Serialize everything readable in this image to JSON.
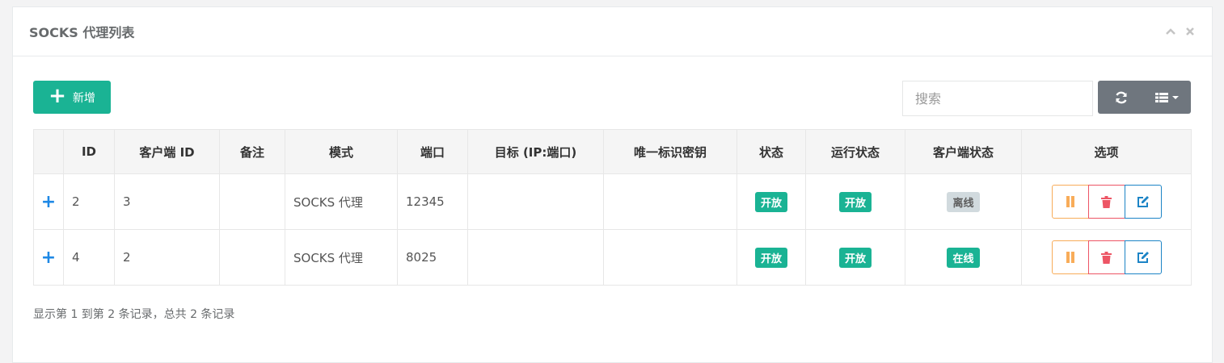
{
  "panel": {
    "title": "SOCKS 代理列表"
  },
  "toolbar": {
    "add_label": "新增",
    "search_placeholder": "搜索"
  },
  "table": {
    "headers": [
      "",
      "ID",
      "客户端 ID",
      "备注",
      "模式",
      "端口",
      "目标 (IP:端口)",
      "唯一标识密钥",
      "状态",
      "运行状态",
      "客户端状态",
      "选项"
    ],
    "rows": [
      {
        "id": "2",
        "client_id": "3",
        "remark": "",
        "mode": "SOCKS 代理",
        "port": "12345",
        "target": "",
        "key": "",
        "status": "开放",
        "run_status": "开放",
        "client_status": "离线"
      },
      {
        "id": "4",
        "client_id": "2",
        "remark": "",
        "mode": "SOCKS 代理",
        "port": "8025",
        "target": "",
        "key": "",
        "status": "开放",
        "run_status": "开放",
        "client_status": "在线"
      }
    ]
  },
  "footer": {
    "summary": "显示第 1 到第 2 条记录，总共 2 条记录"
  },
  "colors": {
    "primary": "#1ab394",
    "warning": "#f8ac59",
    "danger": "#ed5565",
    "info": "#1c84c6",
    "offline": "#d1dade"
  }
}
